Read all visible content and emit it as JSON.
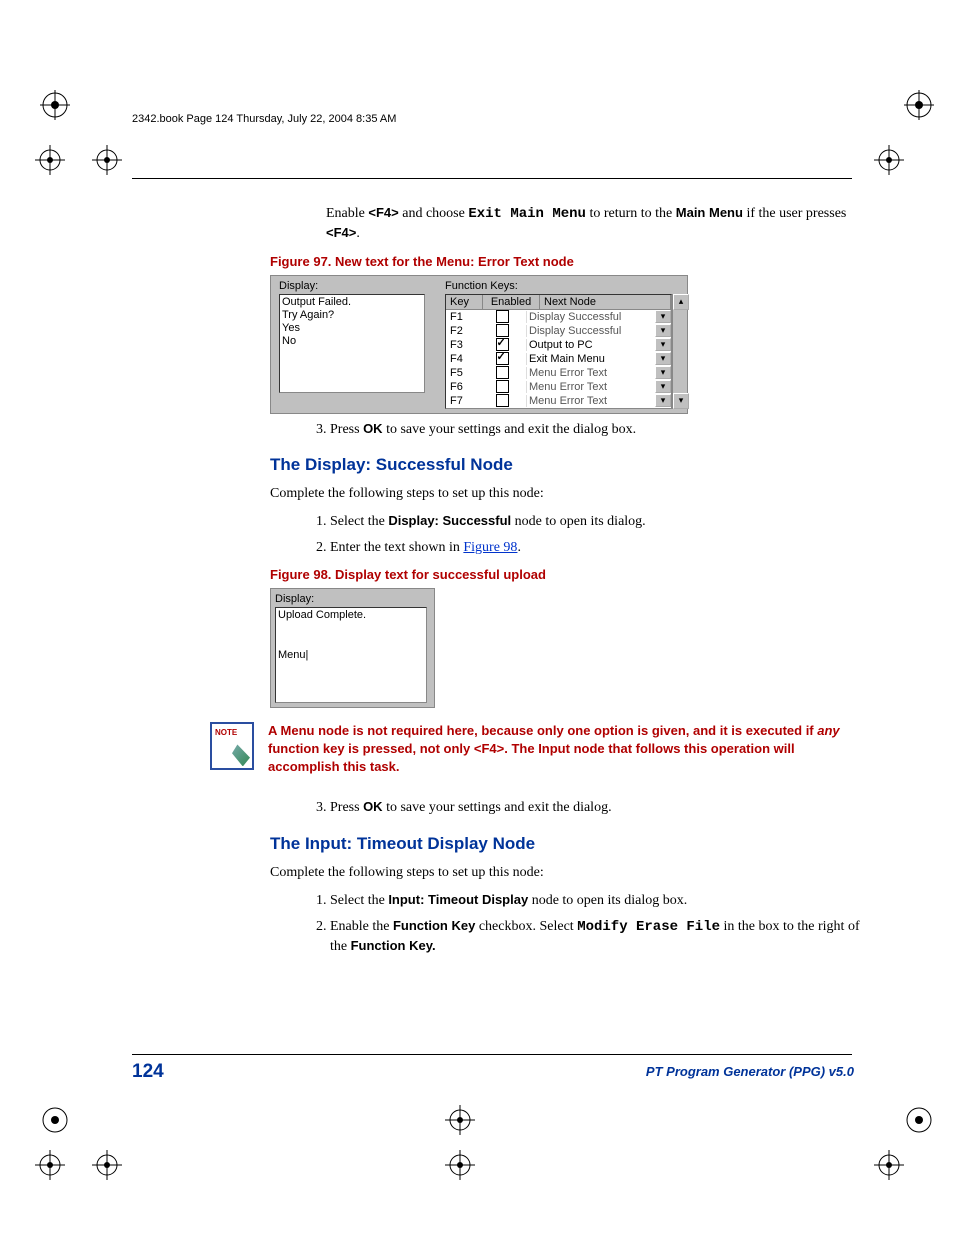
{
  "header": {
    "running_head": "2342.book  Page 124  Thursday, July 22, 2004  8:35 AM"
  },
  "intro": {
    "text_before_f4": "Enable ",
    "f4": "<F4>",
    "text_mid": " and choose ",
    "exit_main_menu": "Exit Main Menu",
    "text_after": " to return to the ",
    "main_menu": "Main Menu",
    "text_end_before": " if the user presses ",
    "f4b": "<F4>",
    "period": "."
  },
  "figure97": {
    "caption": "Figure 97. New text for the Menu: Error Text node",
    "display_label": "Display:",
    "display_text": "Output Failed.\nTry Again?\nYes\nNo",
    "fk_label": "Function Keys:",
    "columns": {
      "key": "Key",
      "enabled": "Enabled",
      "next": "Next Node"
    },
    "rows": [
      {
        "key": "F1",
        "enabled": false,
        "next": "Display Successful"
      },
      {
        "key": "F2",
        "enabled": false,
        "next": "Display Successful"
      },
      {
        "key": "F3",
        "enabled": true,
        "next": "Output to PC"
      },
      {
        "key": "F4",
        "enabled": true,
        "next": "Exit Main Menu"
      },
      {
        "key": "F5",
        "enabled": false,
        "next": "Menu Error Text"
      },
      {
        "key": "F6",
        "enabled": false,
        "next": "Menu Error Text"
      },
      {
        "key": "F7",
        "enabled": false,
        "next": "Menu Error Text"
      }
    ]
  },
  "step3a": {
    "before": "Press ",
    "ok": "OK",
    "after": " to save your settings and exit the dialog box."
  },
  "section1": {
    "heading": "The Display: Successful Node",
    "intro": "Complete the following steps to set up this node:",
    "step1_before": "Select the ",
    "step1_bold": "Display: Successful",
    "step1_after": " node to open its dialog.",
    "step2_before": "Enter the text shown in ",
    "step2_link": "Figure 98",
    "step2_after": "."
  },
  "figure98": {
    "caption": "Figure 98. Display text for successful upload",
    "display_label": "Display:",
    "display_text": "Upload Complete.\n\n\nMenu|"
  },
  "note": {
    "t1": "A ",
    "menu": "Menu",
    "t2": " node is not required here, because only one option is given, and it is executed if ",
    "any": "any",
    "t3": " function key is pressed, not only ",
    "f4": "<F4>",
    "t4": ". The ",
    "input": "Input",
    "t5": " node that follows this operation will accomplish this task."
  },
  "step3b": {
    "before": "Press ",
    "ok": "OK",
    "after": " to save your settings and exit the dialog."
  },
  "section2": {
    "heading": "The Input: Timeout Display Node",
    "intro": "Complete the following steps to set up this node:",
    "step1_before": "Select the ",
    "step1_bold": "Input: Timeout Display",
    "step1_after": " node to open its dialog box.",
    "step2_before": "Enable the ",
    "step2_fk": "Function Key",
    "step2_mid": " checkbox. Select ",
    "step2_mono": "Modify Erase File",
    "step2_after1": " in the box to the right of the ",
    "step2_fk2": "Function Key.",
    "step2_after2": ""
  },
  "footer": {
    "page": "124",
    "title": "PT Program Generator (PPG)  v5.0"
  }
}
